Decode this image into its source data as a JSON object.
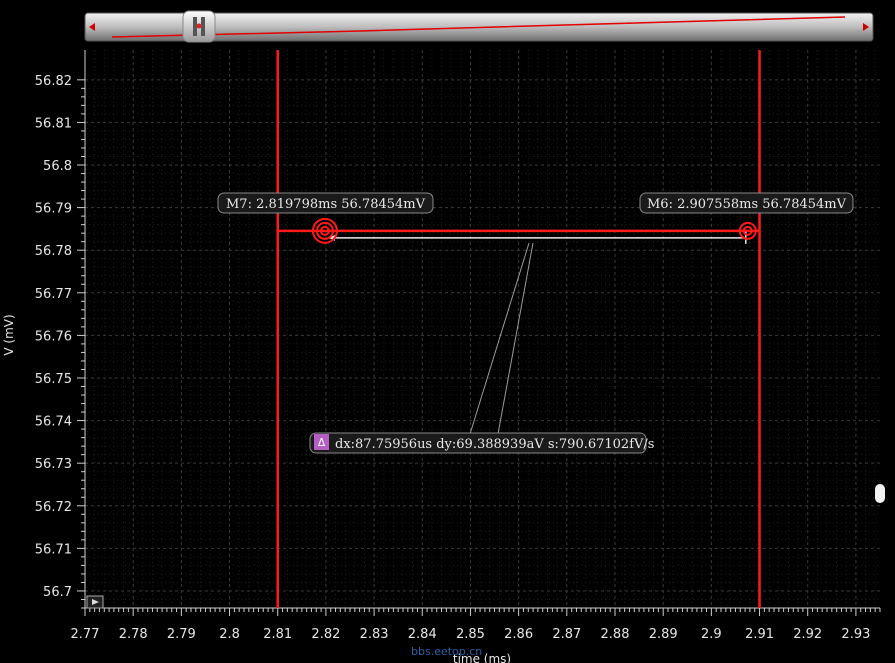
{
  "chart_data": {
    "type": "line",
    "xlabel": "time (ms)",
    "ylabel": "V (mV)",
    "xlim": [
      2.77,
      2.935
    ],
    "ylim": [
      56.696,
      56.827
    ],
    "x_ticks": [
      "2.77",
      "2.78",
      "2.79",
      "2.8",
      "2.81",
      "2.82",
      "2.83",
      "2.84",
      "2.85",
      "2.86",
      "2.87",
      "2.88",
      "2.89",
      "2.9",
      "2.91",
      "2.92",
      "2.93"
    ],
    "y_ticks": [
      "56.82",
      "56.81",
      "56.8",
      "56.79",
      "56.78",
      "56.77",
      "56.76",
      "56.75",
      "56.74",
      "56.73",
      "56.72",
      "56.71",
      "56.7"
    ],
    "grid": true,
    "series": [
      {
        "x": [
          2.77,
          2.935
        ],
        "y": [
          56.78454,
          56.78454
        ]
      }
    ],
    "vertical_markers": [
      2.81,
      2.91
    ],
    "markers": [
      {
        "id": "M7",
        "x": 2.819798,
        "y": 56.78454,
        "label": "M7: 2.819798ms 56.78454mV"
      },
      {
        "id": "M6",
        "x": 2.907558,
        "y": 56.78454,
        "label": "M6: 2.907558ms 56.78454mV"
      }
    ],
    "delta": {
      "icon": "Δ",
      "label": "dx:87.75956us dy:69.388939aV s:790.67102fV/s"
    }
  },
  "watermark": "bbs.eetop.cn",
  "colors": {
    "trace": "#ff1a1a",
    "grid": "#3a3a3a",
    "background": "#000000"
  },
  "icons": {
    "scroll_thumb": "pause-thumb-icon",
    "play": "play-icon",
    "scroll_handle": "scroll-handle-icon"
  }
}
